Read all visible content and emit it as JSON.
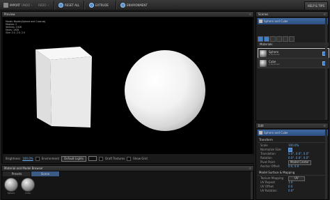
{
  "toolbar": {
    "import": "IMPORT",
    "undo": "UNDO",
    "redo": "REDO",
    "reset_all": "RESET ALL",
    "extrude": "EXTRUDE",
    "environment": "ENVIRONMENT",
    "help": "HELP & TIPS"
  },
  "preview": {
    "title": "Preview",
    "stats": [
      "Model: Models/Sphere and Cube.obj",
      "Meshes: 2",
      "Vertices: 1928",
      "Faces: 1928",
      "Size: 2.0, 2.0, 2.0"
    ],
    "footer": {
      "brightness_label": "Brightness",
      "brightness_value": "100.0%",
      "environment_label": "Environment",
      "lights_value": "Default Lights",
      "draft_label": "Draft Textures",
      "grid_label": "Show Grid"
    }
  },
  "browser": {
    "title": "Material and Model Browser",
    "tabs": [
      "Presets",
      "Scene"
    ],
    "items": [
      "Sphere",
      "Cube"
    ]
  },
  "scenes": {
    "title": "Scenes",
    "selected": "Sphere and Cube",
    "materials_label": "Materials",
    "materials": [
      {
        "name": "Sphere",
        "sub": "2 Textures"
      },
      {
        "name": "Cube",
        "sub": "2 Textures"
      }
    ]
  },
  "edit": {
    "title": "Edit",
    "selected": "Sphere and Cube",
    "transform_label": "Transform",
    "transform": [
      {
        "label": "Scale",
        "value": "100.0%"
      },
      {
        "label": "Normalize Size",
        "value": ""
      },
      {
        "label": "Translation",
        "value": "0.0°, 0.0°, 0.0°"
      },
      {
        "label": "Rotation",
        "value": "0.0°, 0.0°, 0.0°"
      },
      {
        "label": "Pivot Point",
        "value": "Model Center"
      },
      {
        "label": "Anchor Offset",
        "value": "0.0, 0.0"
      }
    ],
    "surface_label": "Model Surface & Mapping",
    "surface": [
      {
        "label": "Texture Mapping",
        "value": "UV"
      },
      {
        "label": "UV Repeat",
        "value": "1.0"
      },
      {
        "label": "UV Offset",
        "value": "0.0"
      },
      {
        "label": "UV Rotation",
        "value": "0.0°"
      }
    ]
  }
}
